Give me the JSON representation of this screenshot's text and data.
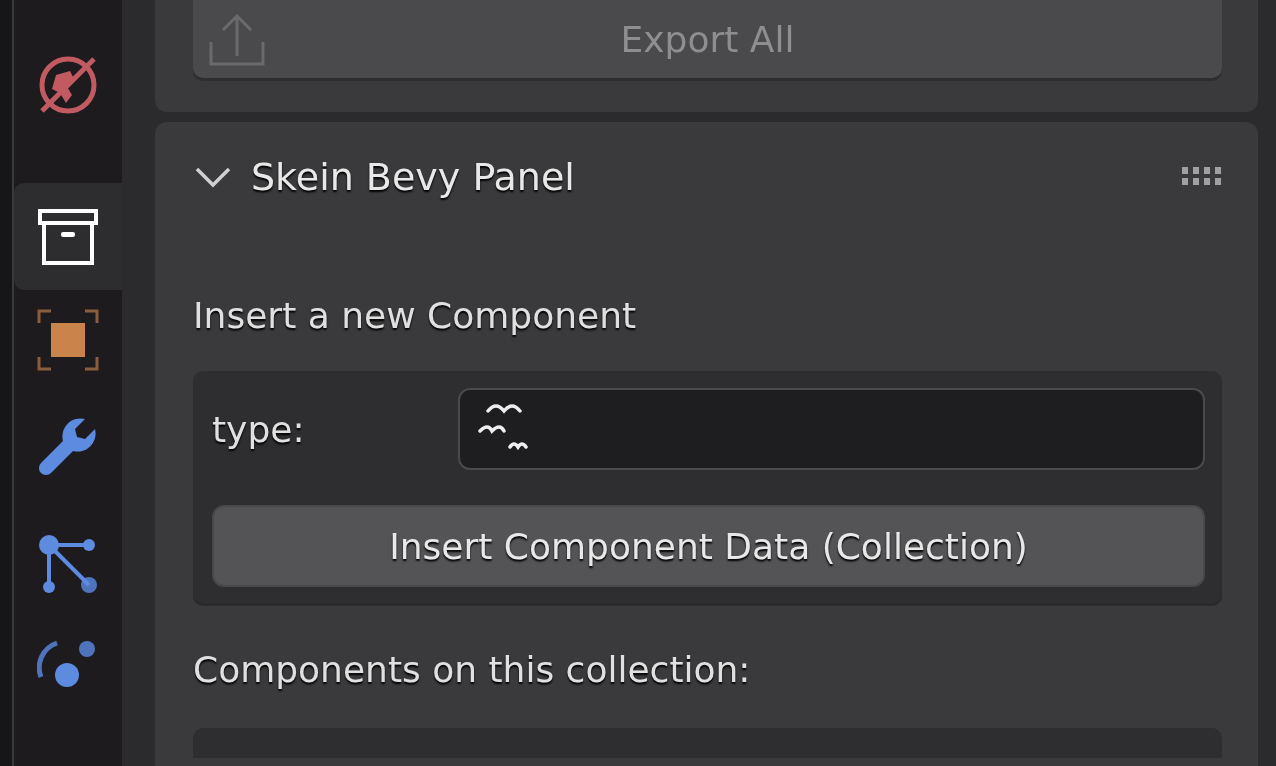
{
  "sidebar": {
    "tabs": [
      {
        "selected": false
      },
      {
        "selected": true
      },
      {
        "selected": false
      },
      {
        "selected": false
      },
      {
        "selected": false
      },
      {
        "selected": false
      }
    ]
  },
  "export_panel": {
    "button": {
      "label": "Export All",
      "disabled": true
    }
  },
  "bevy_panel": {
    "title": "Skein Bevy Panel",
    "expanded": true,
    "insert_heading": "Insert a new Component",
    "type_label": "type:",
    "insert_button": "Insert Component Data (Collection)",
    "components_heading": "Components on this collection:"
  }
}
